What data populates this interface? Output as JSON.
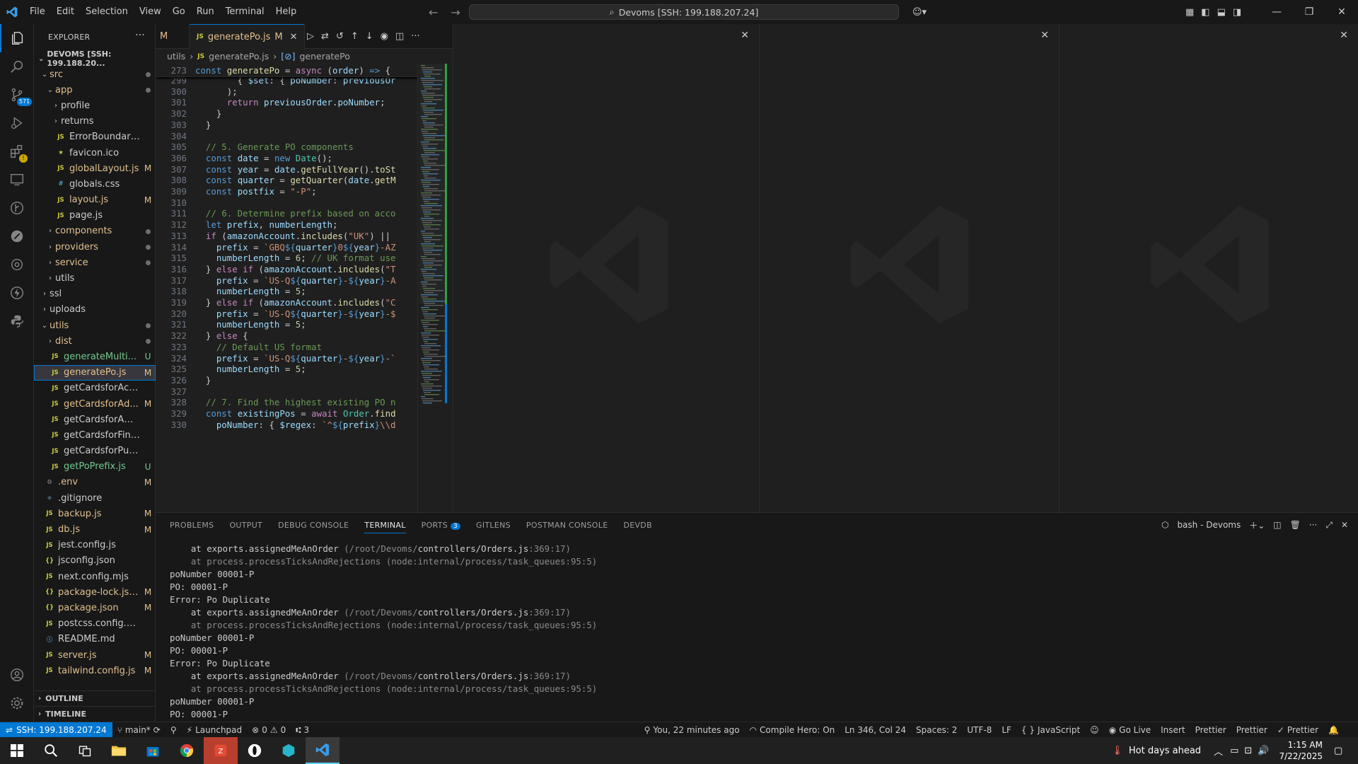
{
  "titlebar": {
    "menu": [
      "File",
      "Edit",
      "Selection",
      "View",
      "Go",
      "Run",
      "Terminal",
      "Help"
    ],
    "command_center": "Devoms [SSH: 199.188.207.24]"
  },
  "activity_bar": {
    "scm_badge": "571"
  },
  "sidebar": {
    "title": "EXPLORER",
    "root": "DEVOMS [SSH: 199.188.20...",
    "outline": "OUTLINE",
    "timeline": "TIMELINE",
    "tree": [
      {
        "indent": 1,
        "type": "folder",
        "open": true,
        "name": "src",
        "status": "dot"
      },
      {
        "indent": 2,
        "type": "folder",
        "open": true,
        "name": "app",
        "status": "dot"
      },
      {
        "indent": 3,
        "type": "folder",
        "open": false,
        "name": "profile",
        "status": ""
      },
      {
        "indent": 3,
        "type": "folder",
        "open": false,
        "name": "returns",
        "status": ""
      },
      {
        "indent": 3,
        "type": "js",
        "name": "ErrorBoundary.js",
        "status": ""
      },
      {
        "indent": 3,
        "type": "star",
        "name": "favicon.ico",
        "status": ""
      },
      {
        "indent": 3,
        "type": "js",
        "name": "globalLayout.js",
        "status": "M"
      },
      {
        "indent": 3,
        "type": "css",
        "name": "globals.css",
        "status": ""
      },
      {
        "indent": 3,
        "type": "js",
        "name": "layout.js",
        "status": "M"
      },
      {
        "indent": 3,
        "type": "js",
        "name": "page.js",
        "status": ""
      },
      {
        "indent": 2,
        "type": "folder",
        "open": false,
        "name": "components",
        "status": "dot"
      },
      {
        "indent": 2,
        "type": "folder",
        "open": false,
        "name": "providers",
        "status": "dot"
      },
      {
        "indent": 2,
        "type": "folder",
        "open": false,
        "name": "service",
        "status": "dot"
      },
      {
        "indent": 2,
        "type": "folder",
        "open": false,
        "name": "utils",
        "status": ""
      },
      {
        "indent": 1,
        "type": "folder",
        "open": false,
        "name": "ssl",
        "status": ""
      },
      {
        "indent": 1,
        "type": "folder",
        "open": false,
        "name": "uploads",
        "status": ""
      },
      {
        "indent": 1,
        "type": "folder",
        "open": true,
        "name": "utils",
        "status": "dot"
      },
      {
        "indent": 2,
        "type": "folder",
        "open": false,
        "name": "dist",
        "status": "dot"
      },
      {
        "indent": 2,
        "type": "js",
        "name": "generateMulti...",
        "status": "U"
      },
      {
        "indent": 2,
        "type": "js",
        "name": "generatePo.js",
        "status": "M",
        "selected": true
      },
      {
        "indent": 2,
        "type": "js",
        "name": "getCardsforAccount.js",
        "status": ""
      },
      {
        "indent": 2,
        "type": "js",
        "name": "getCardsforAd...",
        "status": "M"
      },
      {
        "indent": 2,
        "type": "js",
        "name": "getCardsforAmazon.js",
        "status": ""
      },
      {
        "indent": 2,
        "type": "js",
        "name": "getCardsforFinance.js",
        "status": ""
      },
      {
        "indent": 2,
        "type": "js",
        "name": "getCardsforPurchasi...",
        "status": ""
      },
      {
        "indent": 2,
        "type": "js",
        "name": "getPoPrefix.js",
        "status": "U"
      },
      {
        "indent": 1,
        "type": "gear",
        "name": ".env",
        "status": "M"
      },
      {
        "indent": 1,
        "type": "git",
        "name": ".gitignore",
        "status": ""
      },
      {
        "indent": 1,
        "type": "js",
        "name": "backup.js",
        "status": "M"
      },
      {
        "indent": 1,
        "type": "js",
        "name": "db.js",
        "status": "M"
      },
      {
        "indent": 1,
        "type": "js",
        "name": "jest.config.js",
        "status": ""
      },
      {
        "indent": 1,
        "type": "json",
        "name": "jsconfig.json",
        "status": ""
      },
      {
        "indent": 1,
        "type": "js",
        "name": "next.config.mjs",
        "status": ""
      },
      {
        "indent": 1,
        "type": "json",
        "name": "package-lock.json",
        "status": "M"
      },
      {
        "indent": 1,
        "type": "json",
        "name": "package.json",
        "status": "M"
      },
      {
        "indent": 1,
        "type": "js",
        "name": "postcss.config.mjs",
        "status": ""
      },
      {
        "indent": 1,
        "type": "info",
        "name": "README.md",
        "status": ""
      },
      {
        "indent": 1,
        "type": "js",
        "name": "server.js",
        "status": "M"
      },
      {
        "indent": 1,
        "type": "js",
        "name": "tailwind.config.js",
        "status": "M"
      }
    ]
  },
  "editor": {
    "prev_tab_status": "M",
    "tab": {
      "name": "generatePo.js",
      "status": "M"
    },
    "breadcrumb": [
      "utils",
      "generatePo.js",
      "generatePo"
    ],
    "sticky": {
      "ln": "273",
      "html": "<span class=\"kw\">const</span> <span class=\"fn\">generatePo</span> = <span class=\"kw2\">async</span> (<span class=\"var\">order</span>) <span class=\"kw\">=&gt;</span> {"
    },
    "lines": [
      {
        "ln": "299",
        "html": "        { <span class=\"var\">$set</span>: { <span class=\"var\">poNumber</span>: <span class=\"var\">previousOr</span>"
      },
      {
        "ln": "300",
        "html": "      );"
      },
      {
        "ln": "301",
        "html": "      <span class=\"kw2\">return</span> <span class=\"var\">previousOrder</span>.<span class=\"var\">poNumber</span>;"
      },
      {
        "ln": "302",
        "html": "    }"
      },
      {
        "ln": "303",
        "html": "  }"
      },
      {
        "ln": "304",
        "html": ""
      },
      {
        "ln": "305",
        "html": "  <span class=\"com\">// 5. Generate PO components</span>"
      },
      {
        "ln": "306",
        "html": "  <span class=\"kw\">const</span> <span class=\"var\">date</span> = <span class=\"kw\">new</span> <span class=\"cls\">Date</span>();"
      },
      {
        "ln": "307",
        "html": "  <span class=\"kw\">const</span> <span class=\"var\">year</span> = <span class=\"var\">date</span>.<span class=\"fn\">getFullYear</span>().<span class=\"fn\">toSt</span>"
      },
      {
        "ln": "308",
        "html": "  <span class=\"kw\">const</span> <span class=\"var\">quarter</span> = <span class=\"fn\">getQuarter</span>(<span class=\"var\">date</span>.<span class=\"fn\">getM</span>"
      },
      {
        "ln": "309",
        "html": "  <span class=\"kw\">const</span> <span class=\"var\">postfix</span> = <span class=\"str\">\"-P\"</span>;"
      },
      {
        "ln": "310",
        "html": ""
      },
      {
        "ln": "311",
        "html": "  <span class=\"com\">// 6. Determine prefix based on acco</span>"
      },
      {
        "ln": "312",
        "html": "  <span class=\"kw\">let</span> <span class=\"var\">prefix</span>, <span class=\"var\">numberLength</span>;"
      },
      {
        "ln": "313",
        "html": "  <span class=\"kw2\">if</span> (<span class=\"var\">amazonAccount</span>.<span class=\"fn\">includes</span>(<span class=\"str\">\"UK\"</span>) ||"
      },
      {
        "ln": "314",
        "html": "    <span class=\"var\">prefix</span> = <span class=\"str\">`GBQ</span><span class=\"tpl\">${</span><span class=\"var\">quarter</span><span class=\"tpl\">}</span><span class=\"str\">0</span><span class=\"tpl\">${</span><span class=\"var\">year</span><span class=\"tpl\">}</span><span class=\"str\">-AZ</span>"
      },
      {
        "ln": "315",
        "html": "    <span class=\"var\">numberLength</span> = <span class=\"num\">6</span>; <span class=\"com\">// UK format use</span>"
      },
      {
        "ln": "316",
        "html": "  } <span class=\"kw2\">else if</span> (<span class=\"var\">amazonAccount</span>.<span class=\"fn\">includes</span>(<span class=\"str\">\"T</span>"
      },
      {
        "ln": "317",
        "html": "    <span class=\"var\">prefix</span> = <span class=\"str\">`US-Q</span><span class=\"tpl\">${</span><span class=\"var\">quarter</span><span class=\"tpl\">}</span><span class=\"str\">-</span><span class=\"tpl\">${</span><span class=\"var\">year</span><span class=\"tpl\">}</span><span class=\"str\">-A</span>"
      },
      {
        "ln": "318",
        "html": "    <span class=\"var\">numberLength</span> = <span class=\"num\">5</span>;"
      },
      {
        "ln": "319",
        "html": "  } <span class=\"kw2\">else if</span> (<span class=\"var\">amazonAccount</span>.<span class=\"fn\">includes</span>(<span class=\"str\">\"C</span>"
      },
      {
        "ln": "320",
        "html": "    <span class=\"var\">prefix</span> = <span class=\"str\">`US-Q</span><span class=\"tpl\">${</span><span class=\"var\">quarter</span><span class=\"tpl\">}</span><span class=\"str\">-</span><span class=\"tpl\">${</span><span class=\"var\">year</span><span class=\"tpl\">}</span><span class=\"str\">-$</span>"
      },
      {
        "ln": "321",
        "html": "    <span class=\"var\">numberLength</span> = <span class=\"num\">5</span>;"
      },
      {
        "ln": "322",
        "html": "  } <span class=\"kw2\">else</span> {"
      },
      {
        "ln": "323",
        "html": "    <span class=\"com\">// Default US format</span>"
      },
      {
        "ln": "324",
        "html": "    <span class=\"var\">prefix</span> = <span class=\"str\">`US-Q</span><span class=\"tpl\">${</span><span class=\"var\">quarter</span><span class=\"tpl\">}</span><span class=\"str\">-</span><span class=\"tpl\">${</span><span class=\"var\">year</span><span class=\"tpl\">}</span><span class=\"str\">-`</span>"
      },
      {
        "ln": "325",
        "html": "    <span class=\"var\">numberLength</span> = <span class=\"num\">5</span>;"
      },
      {
        "ln": "326",
        "html": "  }"
      },
      {
        "ln": "327",
        "html": ""
      },
      {
        "ln": "328",
        "html": "  <span class=\"com\">// 7. Find the highest existing PO n</span>"
      },
      {
        "ln": "329",
        "html": "  <span class=\"kw\">const</span> <span class=\"var\">existingPos</span> = <span class=\"kw2\">await</span> <span class=\"cls\">Order</span>.<span class=\"fn\">find</span>"
      },
      {
        "ln": "330",
        "html": "    <span class=\"var\">poNumber</span>: { <span class=\"var\">$regex</span>: <span class=\"str\">`^</span><span class=\"tpl\">${</span><span class=\"var\">prefix</span><span class=\"tpl\">}</span><span class=\"str\">\\\\d</span>"
      }
    ]
  },
  "panel": {
    "tabs": [
      "PROBLEMS",
      "OUTPUT",
      "DEBUG CONSOLE",
      "TERMINAL",
      "PORTS",
      "GITLENS",
      "POSTMAN CONSOLE",
      "DEVDB"
    ],
    "active_tab": "TERMINAL",
    "ports_badge": "3",
    "terminal_name": "bash - Devoms",
    "terminal_lines": [
      {
        "dim": false,
        "pre": "    at exports.assignedMeAnOrder ",
        "dimtail": "(/root/Devoms/",
        "mid": "controllers/Orders.js",
        "end": ":369:17)"
      },
      {
        "dim": true,
        "text": "    at process.processTicksAndRejections (node:internal/process/task_queues:95:5)"
      },
      {
        "dim": false,
        "text": "poNumber 00001-P"
      },
      {
        "dim": false,
        "text": "PO: 00001-P"
      },
      {
        "dim": false,
        "text": "Error: Po Duplicate"
      },
      {
        "dim": false,
        "pre": "    at exports.assignedMeAnOrder ",
        "dimtail": "(/root/Devoms/",
        "mid": "controllers/Orders.js",
        "end": ":369:17)"
      },
      {
        "dim": true,
        "text": "    at process.processTicksAndRejections (node:internal/process/task_queues:95:5)"
      },
      {
        "dim": false,
        "text": "poNumber 00001-P"
      },
      {
        "dim": false,
        "text": "PO: 00001-P"
      },
      {
        "dim": false,
        "text": "Error: Po Duplicate"
      },
      {
        "dim": false,
        "pre": "    at exports.assignedMeAnOrder ",
        "dimtail": "(/root/Devoms/",
        "mid": "controllers/Orders.js",
        "end": ":369:17)"
      },
      {
        "dim": true,
        "text": "    at process.processTicksAndRejections (node:internal/process/task_queues:95:5)"
      },
      {
        "dim": false,
        "text": "poNumber 00001-P"
      },
      {
        "dim": false,
        "text": "PO: 00001-P"
      }
    ]
  },
  "statusbar": {
    "remote": "SSH: 199.188.207.24",
    "branch": "main*",
    "launchpad": "Launchpad",
    "errors": "0",
    "warnings": "0",
    "ports": "3",
    "blame": "You, 22 minutes ago",
    "compile_hero": "Compile Hero: On",
    "position": "Ln 346, Col 24",
    "spaces": "Spaces: 2",
    "encoding": "UTF-8",
    "eol": "LF",
    "language": "JavaScript",
    "golive": "Go Live",
    "insert": "Insert",
    "prettier1": "Prettier",
    "prettier2": "Prettier",
    "prettier3": "Prettier"
  },
  "taskbar": {
    "weather": "Hot days ahead",
    "time": "1:15 AM",
    "date": "7/22/2025"
  },
  "colors": {
    "accent": "#0078d4",
    "modified": "#e2c08d",
    "untracked": "#73c991"
  }
}
